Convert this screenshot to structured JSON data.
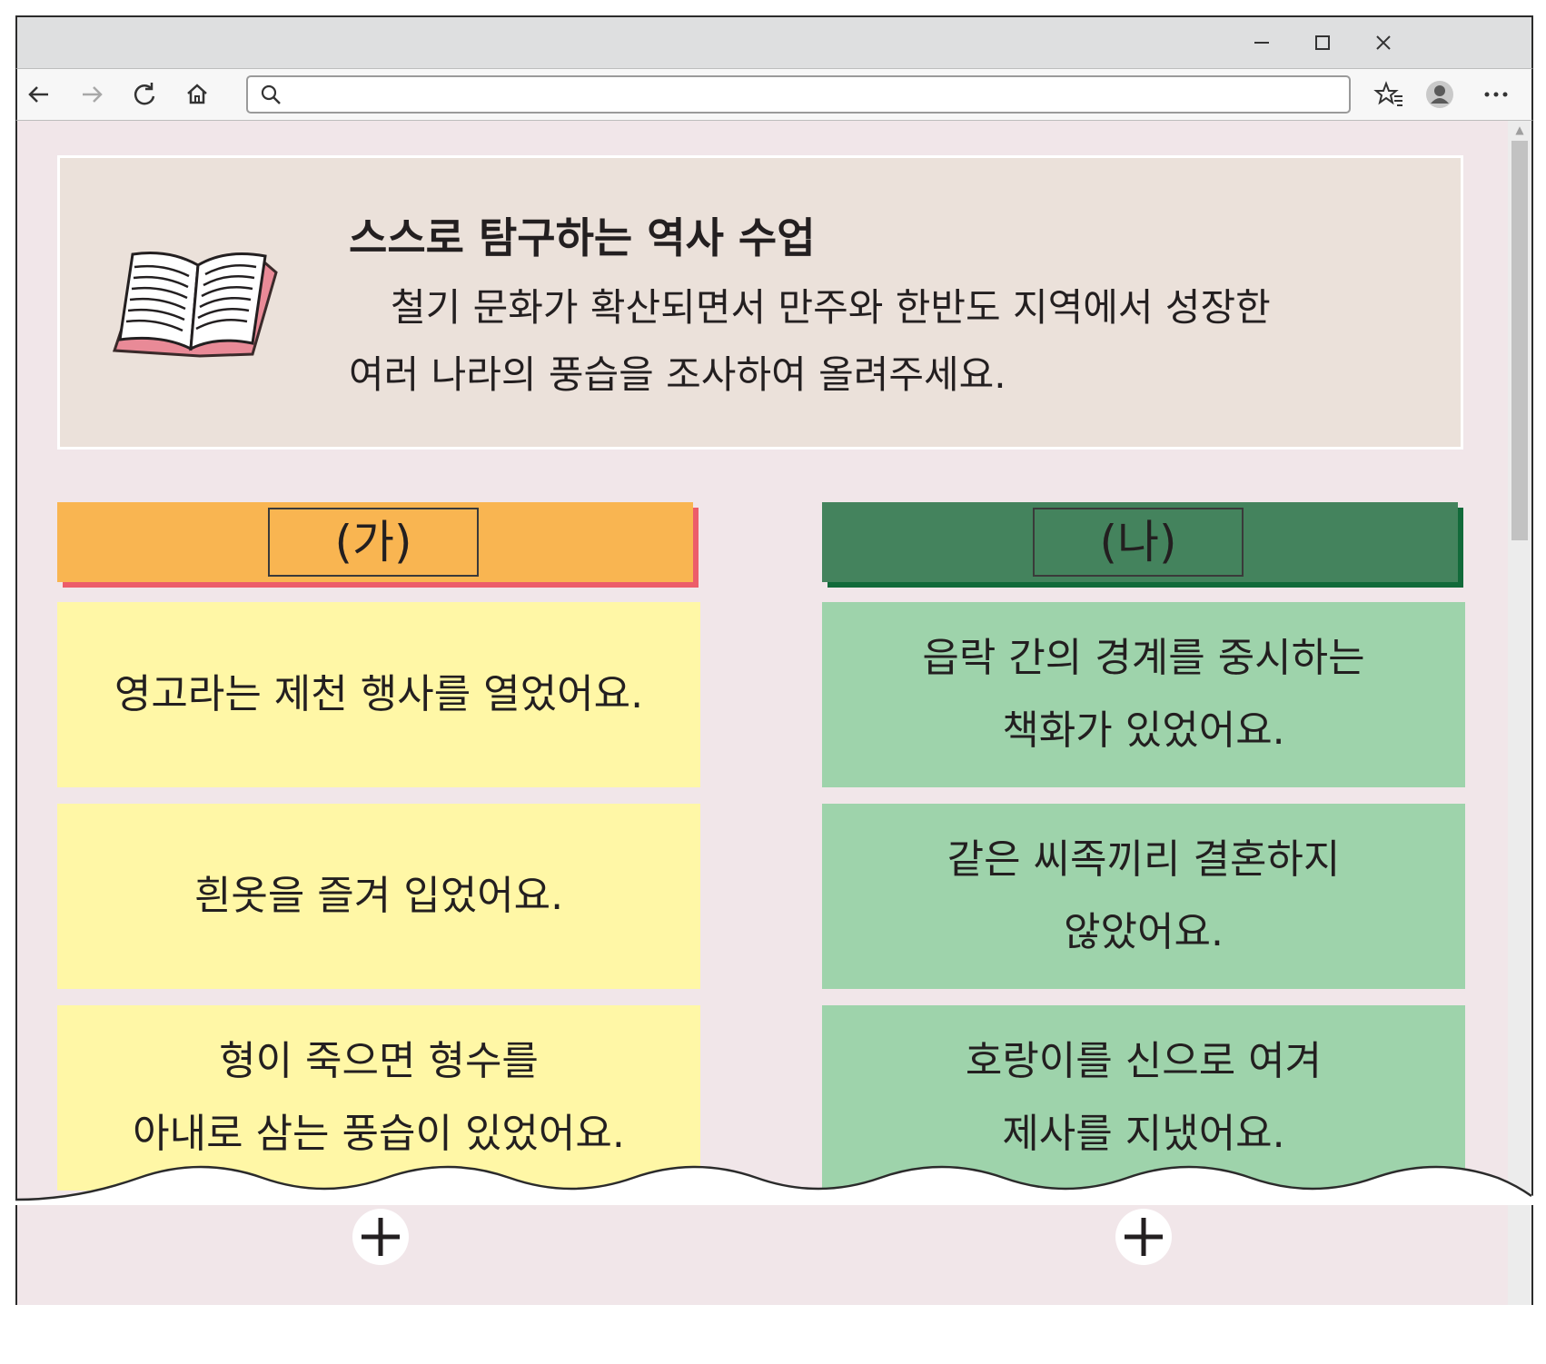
{
  "window": {
    "controls": {
      "minimize_icon": "minimize-icon",
      "maximize_icon": "maximize-icon",
      "close_icon": "close-icon"
    }
  },
  "toolbar": {
    "back_icon": "back-arrow-icon",
    "forward_icon": "forward-arrow-icon",
    "reload_icon": "reload-icon",
    "home_icon": "home-icon",
    "address": {
      "value": "",
      "search_icon": "search-icon"
    },
    "favorites_icon": "favorites-star-icon",
    "profile_icon": "profile-avatar-icon",
    "menu_icon": "more-menu-icon"
  },
  "prompt": {
    "icon": "open-book-icon",
    "title": "스스로 탐구하는 역사 수업",
    "body_lines": [
      "철기 문화가 확산되면서 만주와 한반도 지역에서 성장한",
      "여러 나라의 풍습을 조사하여 올려주세요."
    ]
  },
  "columns": [
    {
      "label": "(가)",
      "header_color": "#f9b551",
      "shadow_color": "#ec5d6a",
      "card_color": "#fff7a6",
      "cards": [
        {
          "lines": [
            "영고라는 제천 행사를 열었어요."
          ]
        },
        {
          "lines": [
            "흰옷을 즐겨 입었어요."
          ]
        },
        {
          "lines": [
            "형이 죽으면 형수를",
            "아내로 삼는 풍습이 있었어요."
          ]
        }
      ],
      "add_icon": "plus-icon"
    },
    {
      "label": "(나)",
      "header_color": "#44835d",
      "shadow_color": "#126a3a",
      "card_color": "#9ed3ab",
      "cards": [
        {
          "lines": [
            "읍락 간의 경계를 중시하는",
            "책화가 있었어요."
          ]
        },
        {
          "lines": [
            "같은 씨족끼리 결혼하지",
            "않았어요."
          ]
        },
        {
          "lines": [
            "호랑이를 신으로 여겨",
            "제사를 지냈어요."
          ]
        }
      ],
      "add_icon": "plus-icon"
    }
  ],
  "colors": {
    "page_background": "#f1e6e9",
    "prompt_background": "#ebe1da",
    "titlebar": "#dedfe0"
  }
}
